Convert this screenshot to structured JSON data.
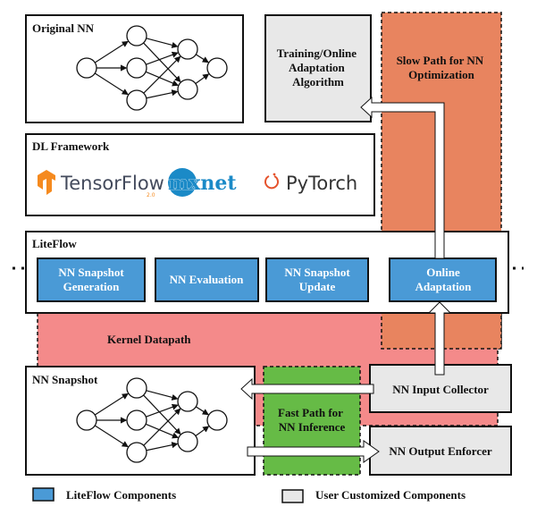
{
  "original_nn": {
    "label": "Original NN"
  },
  "training": {
    "lines": [
      "Training/Online",
      "Adaptation",
      "Algorithm"
    ]
  },
  "slow_path": {
    "lines": [
      "Slow Path for NN",
      "Optimization"
    ],
    "color": "#e8845f"
  },
  "dl_framework": {
    "label": "DL Framework",
    "logos": [
      "TensorFlow",
      "2.0",
      "mxnet",
      "PyTorch"
    ]
  },
  "liteflow": {
    "label": "LiteFlow",
    "components": [
      {
        "lines": [
          "NN Snapshot",
          "Generation"
        ]
      },
      {
        "lines": [
          "NN Evaluation"
        ]
      },
      {
        "lines": [
          "NN Snapshot",
          "Update"
        ]
      },
      {
        "lines": [
          "Online",
          "Adaptation"
        ]
      }
    ],
    "color": "#4a9ad6"
  },
  "kernel_datapath": {
    "label": "Kernel Datapath",
    "color": "#f48a8a"
  },
  "nn_snapshot": {
    "label": "NN Snapshot"
  },
  "fast_path": {
    "lines": [
      "Fast Path for",
      "NN Inference"
    ],
    "color": "#66bb46"
  },
  "input_collector": {
    "label": "NN Input Collector"
  },
  "output_enforcer": {
    "label": "NN Output Enforcer"
  },
  "legend": [
    {
      "label": "LiteFlow Components",
      "color": "#4a9ad6"
    },
    {
      "label": "User Customized Components",
      "color": "#e8e8e8"
    }
  ]
}
